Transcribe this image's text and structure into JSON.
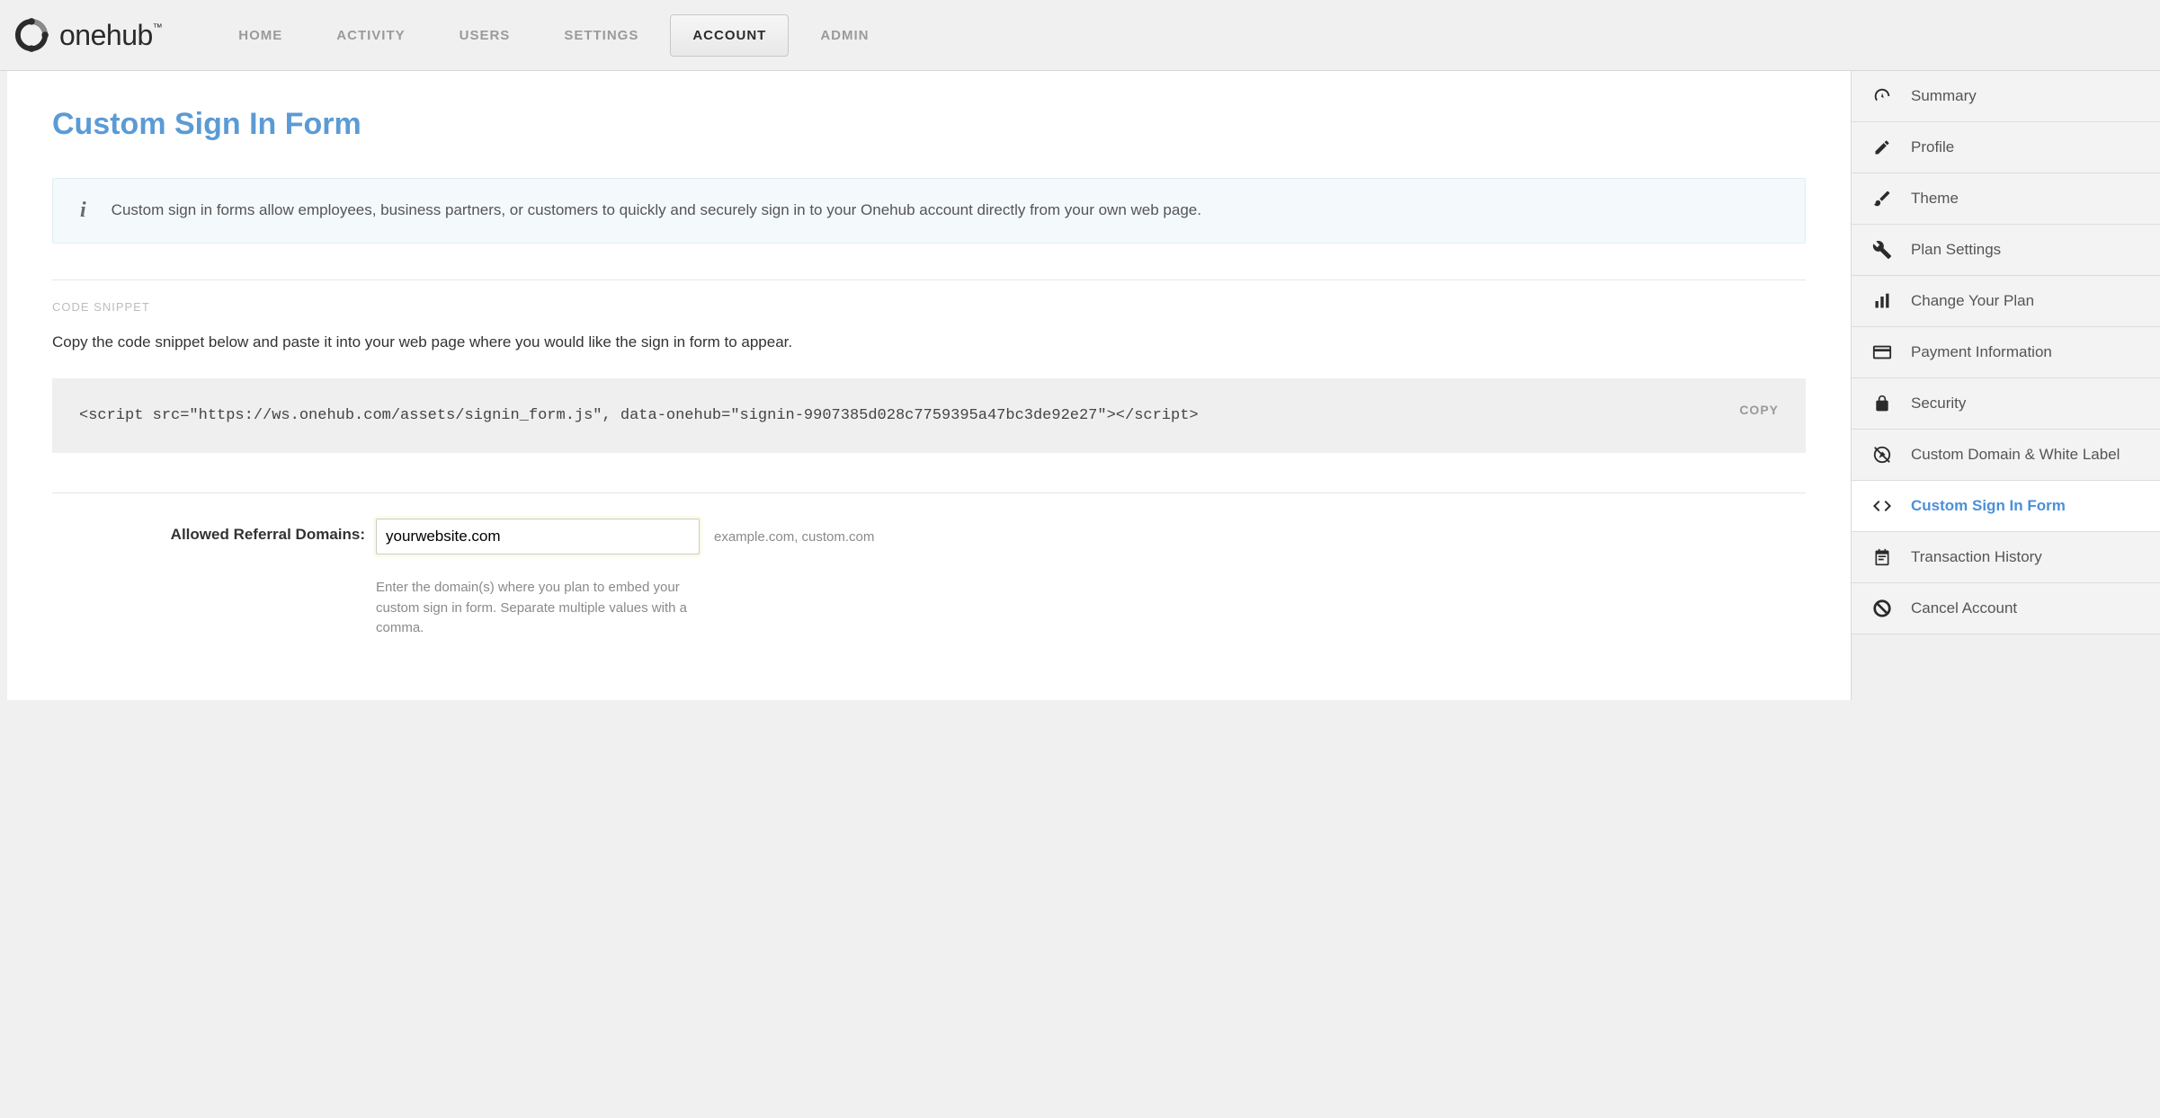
{
  "brand": "onehub",
  "nav": {
    "items": [
      {
        "label": "HOME"
      },
      {
        "label": "ACTIVITY"
      },
      {
        "label": "USERS"
      },
      {
        "label": "SETTINGS"
      },
      {
        "label": "ACCOUNT"
      },
      {
        "label": "ADMIN"
      }
    ],
    "active_index": 4
  },
  "page": {
    "title": "Custom Sign In Form",
    "info": "Custom sign in forms allow employees, business partners, or customers to quickly and securely sign in to your Onehub account directly from your own web page.",
    "code_section_label": "CODE SNIPPET",
    "code_section_desc": "Copy the code snippet below and paste it into your web page where you would like the sign in form to appear.",
    "code_snippet": "<script src=\"https://ws.onehub.com/assets/signin_form.js\", data-onehub=\"signin-9907385d028c7759395a47bc3de92e27\"></script>",
    "copy_label": "COPY",
    "form": {
      "label": "Allowed Referral Domains:",
      "value": "yourwebsite.com",
      "hint": "example.com, custom.com",
      "help": "Enter the domain(s) where you plan to embed your custom sign in form. Separate multiple values with a comma."
    }
  },
  "sidebar": {
    "items": [
      {
        "label": "Summary",
        "icon": "gauge-icon"
      },
      {
        "label": "Profile",
        "icon": "pencil-icon"
      },
      {
        "label": "Theme",
        "icon": "paint-icon"
      },
      {
        "label": "Plan Settings",
        "icon": "tools-icon"
      },
      {
        "label": "Change Your Plan",
        "icon": "bars-icon"
      },
      {
        "label": "Payment Information",
        "icon": "card-icon"
      },
      {
        "label": "Security",
        "icon": "lock-icon"
      },
      {
        "label": "Custom Domain & White Label",
        "icon": "compass-off-icon"
      },
      {
        "label": "Custom Sign In Form",
        "icon": "code-icon"
      },
      {
        "label": "Transaction History",
        "icon": "notepad-icon"
      },
      {
        "label": "Cancel Account",
        "icon": "ban-icon"
      }
    ],
    "active_index": 8
  }
}
